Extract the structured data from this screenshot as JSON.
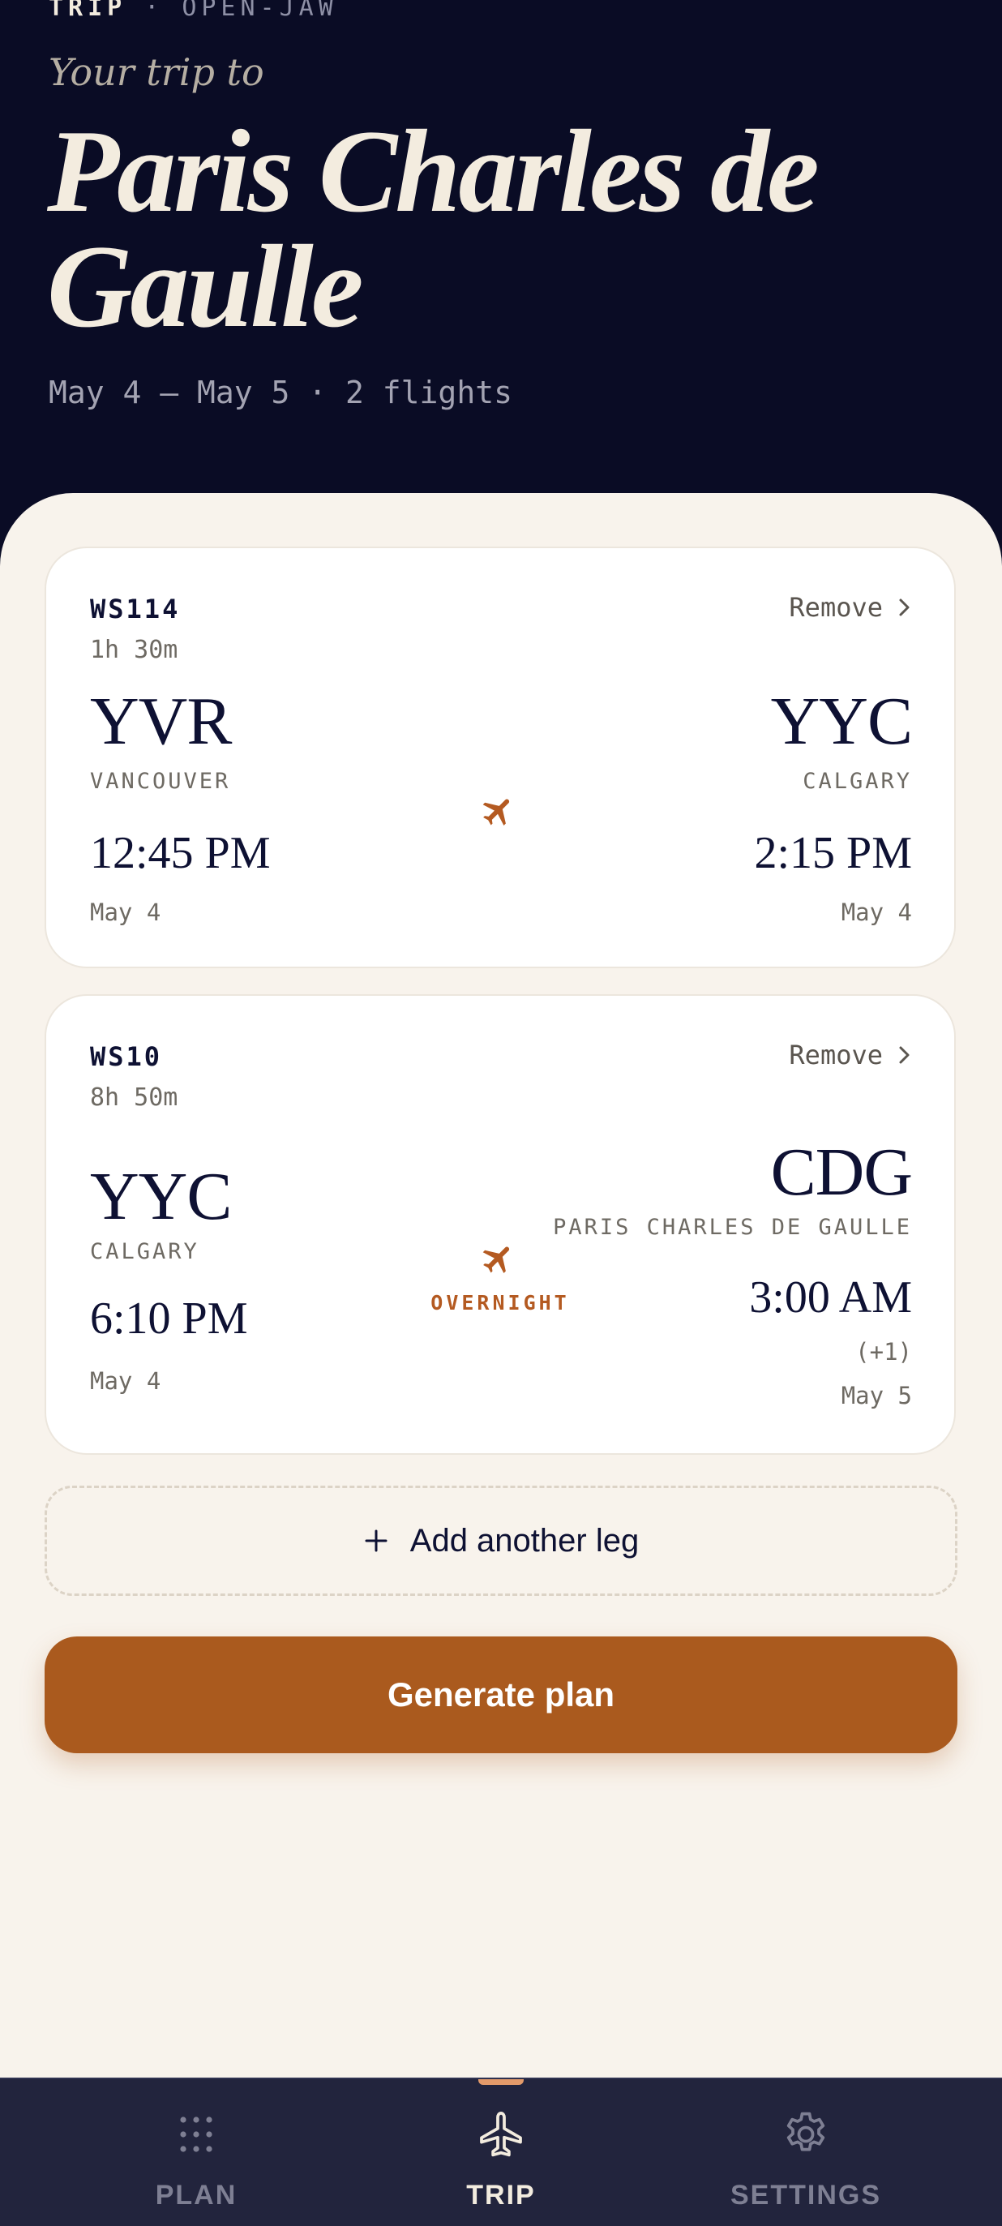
{
  "header": {
    "eyebrow_primary": "TRIP",
    "eyebrow_separator": "·",
    "eyebrow_secondary": "OPEN-JAW",
    "kicker": "Your trip to",
    "title": "Paris Charles de Gaulle",
    "meta": "May 4 – May 5 · 2 flights"
  },
  "legs": [
    {
      "flight_number": "WS114",
      "duration": "1h 30m",
      "remove_label": "Remove",
      "origin": {
        "code": "YVR",
        "city": "VANCOUVER",
        "time": "12:45 PM",
        "date": "May 4"
      },
      "destination": {
        "code": "YYC",
        "city": "CALGARY",
        "time": "2:15 PM",
        "date": "May 4"
      }
    },
    {
      "flight_number": "WS10",
      "duration": "8h 50m",
      "remove_label": "Remove",
      "badge": "OVERNIGHT",
      "origin": {
        "code": "YYC",
        "city": "CALGARY",
        "time": "6:10 PM",
        "date": "May 4"
      },
      "destination": {
        "code": "CDG",
        "city": "PARIS CHARLES DE GAULLE",
        "time": "3:00 AM",
        "day_offset": "(+1)",
        "date": "May 5"
      }
    }
  ],
  "actions": {
    "add_leg_label": "Add another leg",
    "generate_label": "Generate plan"
  },
  "nav": {
    "items": [
      {
        "label": "PLAN",
        "icon": "grid-dots-icon",
        "active": false
      },
      {
        "label": "TRIP",
        "icon": "airplane-icon",
        "active": true
      },
      {
        "label": "SETTINGS",
        "icon": "gear-icon",
        "active": false
      }
    ]
  },
  "colors": {
    "header_bg": "#0A0C25",
    "sheet_bg": "#F8F3EC",
    "accent": "#AA5A1E",
    "nav_bg": "#22243D",
    "nav_indicator": "#E39A6A"
  }
}
